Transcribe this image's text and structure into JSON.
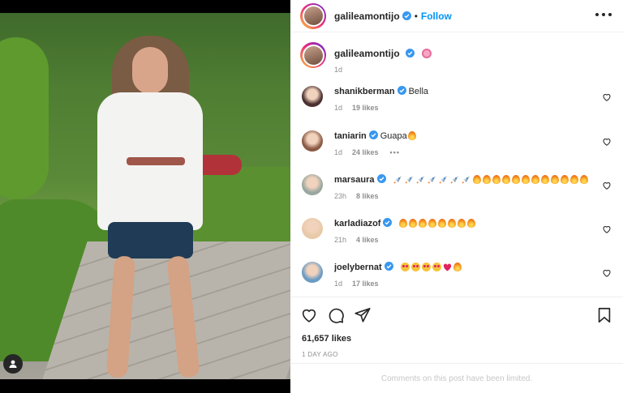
{
  "post": {
    "username": "galileamontijo",
    "follow_label": "Follow",
    "dot": "•"
  },
  "caption": {
    "username": "galileamontijo",
    "time": "1d"
  },
  "comments": [
    {
      "username": "shanikberman",
      "text": "Bella",
      "time": "1d",
      "likes": "19 likes",
      "emojis": [],
      "verified": true,
      "avatar_color": "#4a3030"
    },
    {
      "username": "taniarin",
      "text": "Guapa",
      "time": "1d",
      "likes": "24 likes",
      "emojis": [
        "fire"
      ],
      "verified": true,
      "more": "•••",
      "avatar_color": "#8a5a45"
    },
    {
      "username": "marsaura",
      "text": "",
      "time": "23h",
      "likes": "8 likes",
      "emojis": [
        "rocket",
        "rocket",
        "rocket",
        "rocket",
        "rocket",
        "rocket",
        "rocket",
        "fire",
        "fire",
        "fire",
        "fire",
        "fire",
        "fire",
        "fire",
        "fire",
        "fire",
        "fire",
        "fire",
        "fire"
      ],
      "verified": true,
      "avatar_color": "#9aa7a0"
    },
    {
      "username": "karladiazof",
      "text": "",
      "time": "21h",
      "likes": "4 likes",
      "emojis": [
        "fire",
        "fire",
        "fire",
        "fire",
        "fire",
        "fire",
        "fire",
        "fire"
      ],
      "verified": true,
      "avatar_color": "#e8c9a8"
    },
    {
      "username": "joelybernat",
      "text": "",
      "time": "1d",
      "likes": "17 likes",
      "emojis": [
        "star-struck",
        "star-struck",
        "star-struck",
        "star-struck",
        "red-heart",
        "fire"
      ],
      "verified": true,
      "avatar_color": "#6b9bc2"
    }
  ],
  "likes_total": "61,657 likes",
  "time_ago": "1 DAY AGO",
  "limited_text": "Comments on this post have been limited.",
  "colors": {
    "link_blue": "#0095f6",
    "verified_blue": "#3897f0",
    "muted": "#8e8e8e"
  }
}
